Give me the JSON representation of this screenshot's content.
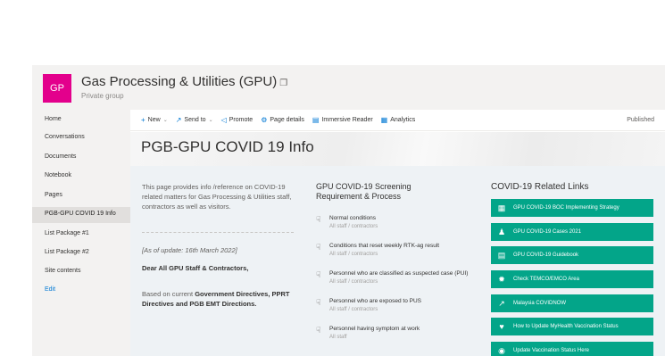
{
  "site": {
    "logo_text": "GP",
    "title": "Gas Processing & Utilities (GPU)",
    "title_icon": "sticker-icon",
    "subtitle": "Private group",
    "brand_color": "#e3008c"
  },
  "nav": {
    "items": [
      {
        "label": "Home"
      },
      {
        "label": "Conversations"
      },
      {
        "label": "Documents"
      },
      {
        "label": "Notebook"
      },
      {
        "label": "Pages"
      },
      {
        "label": "PGB-GPU COVID 19 Info"
      },
      {
        "label": "List Package #1"
      },
      {
        "label": "List Package #2"
      },
      {
        "label": "Site contents"
      },
      {
        "label": "Edit"
      }
    ],
    "active_index": 5
  },
  "commands": {
    "new_label": "New",
    "send_to_label": "Send to",
    "promote_label": "Promote",
    "page_details_label": "Page details",
    "immersive_reader_label": "Immersive Reader",
    "analytics_label": "Analytics",
    "status": "Published"
  },
  "page": {
    "title": "PGB-GPU COVID 19 Info"
  },
  "intro": {
    "text": "This page provides info /reference on COVID-19 related matters for Gas Processing & Utilities staff, contractors as well as visitors.",
    "update": "[As of update: 16th March 2022]",
    "greeting": "Dear All GPU Staff & Contractors,",
    "based_prefix": "Based on current ",
    "based_bold": "Government Directives, PPRT Directives and PGB EMT Directions."
  },
  "screening": {
    "title": "GPU COVID-19 Screening Requirement & Process",
    "items": [
      {
        "title": "Normal conditions",
        "sub": "All staff / contractors"
      },
      {
        "title": "Conditions that reset weekly RTK-ag result",
        "sub": "All staff / contractors"
      },
      {
        "title": "Personnel who are classified as suspected case (PUI)",
        "sub": "All staff / contractors"
      },
      {
        "title": "Personnel who are exposed to PUS",
        "sub": "All staff / contractors"
      },
      {
        "title": "Personnel having symptom at work",
        "sub": "All staff"
      }
    ]
  },
  "links": {
    "title": "COVID-19 Related Links",
    "accent": "#03a589",
    "items": [
      {
        "label": "GPU COVID-19 BOC Implementing Strategy",
        "icon": "table-icon"
      },
      {
        "label": "GPU COVID-19 Cases 2021",
        "icon": "people-icon"
      },
      {
        "label": "GPU COVID-19 Guidebook",
        "icon": "book-icon"
      },
      {
        "label": "Check TEMCO/EMCO Area",
        "icon": "virus-icon"
      },
      {
        "label": "Malaysia COVIDNOW",
        "icon": "line-chart-icon"
      },
      {
        "label": "How to Update MyHealth Vaccination Status",
        "icon": "heart-icon"
      },
      {
        "label": "Update Vaccination Status Here",
        "icon": "globe-icon"
      }
    ]
  }
}
